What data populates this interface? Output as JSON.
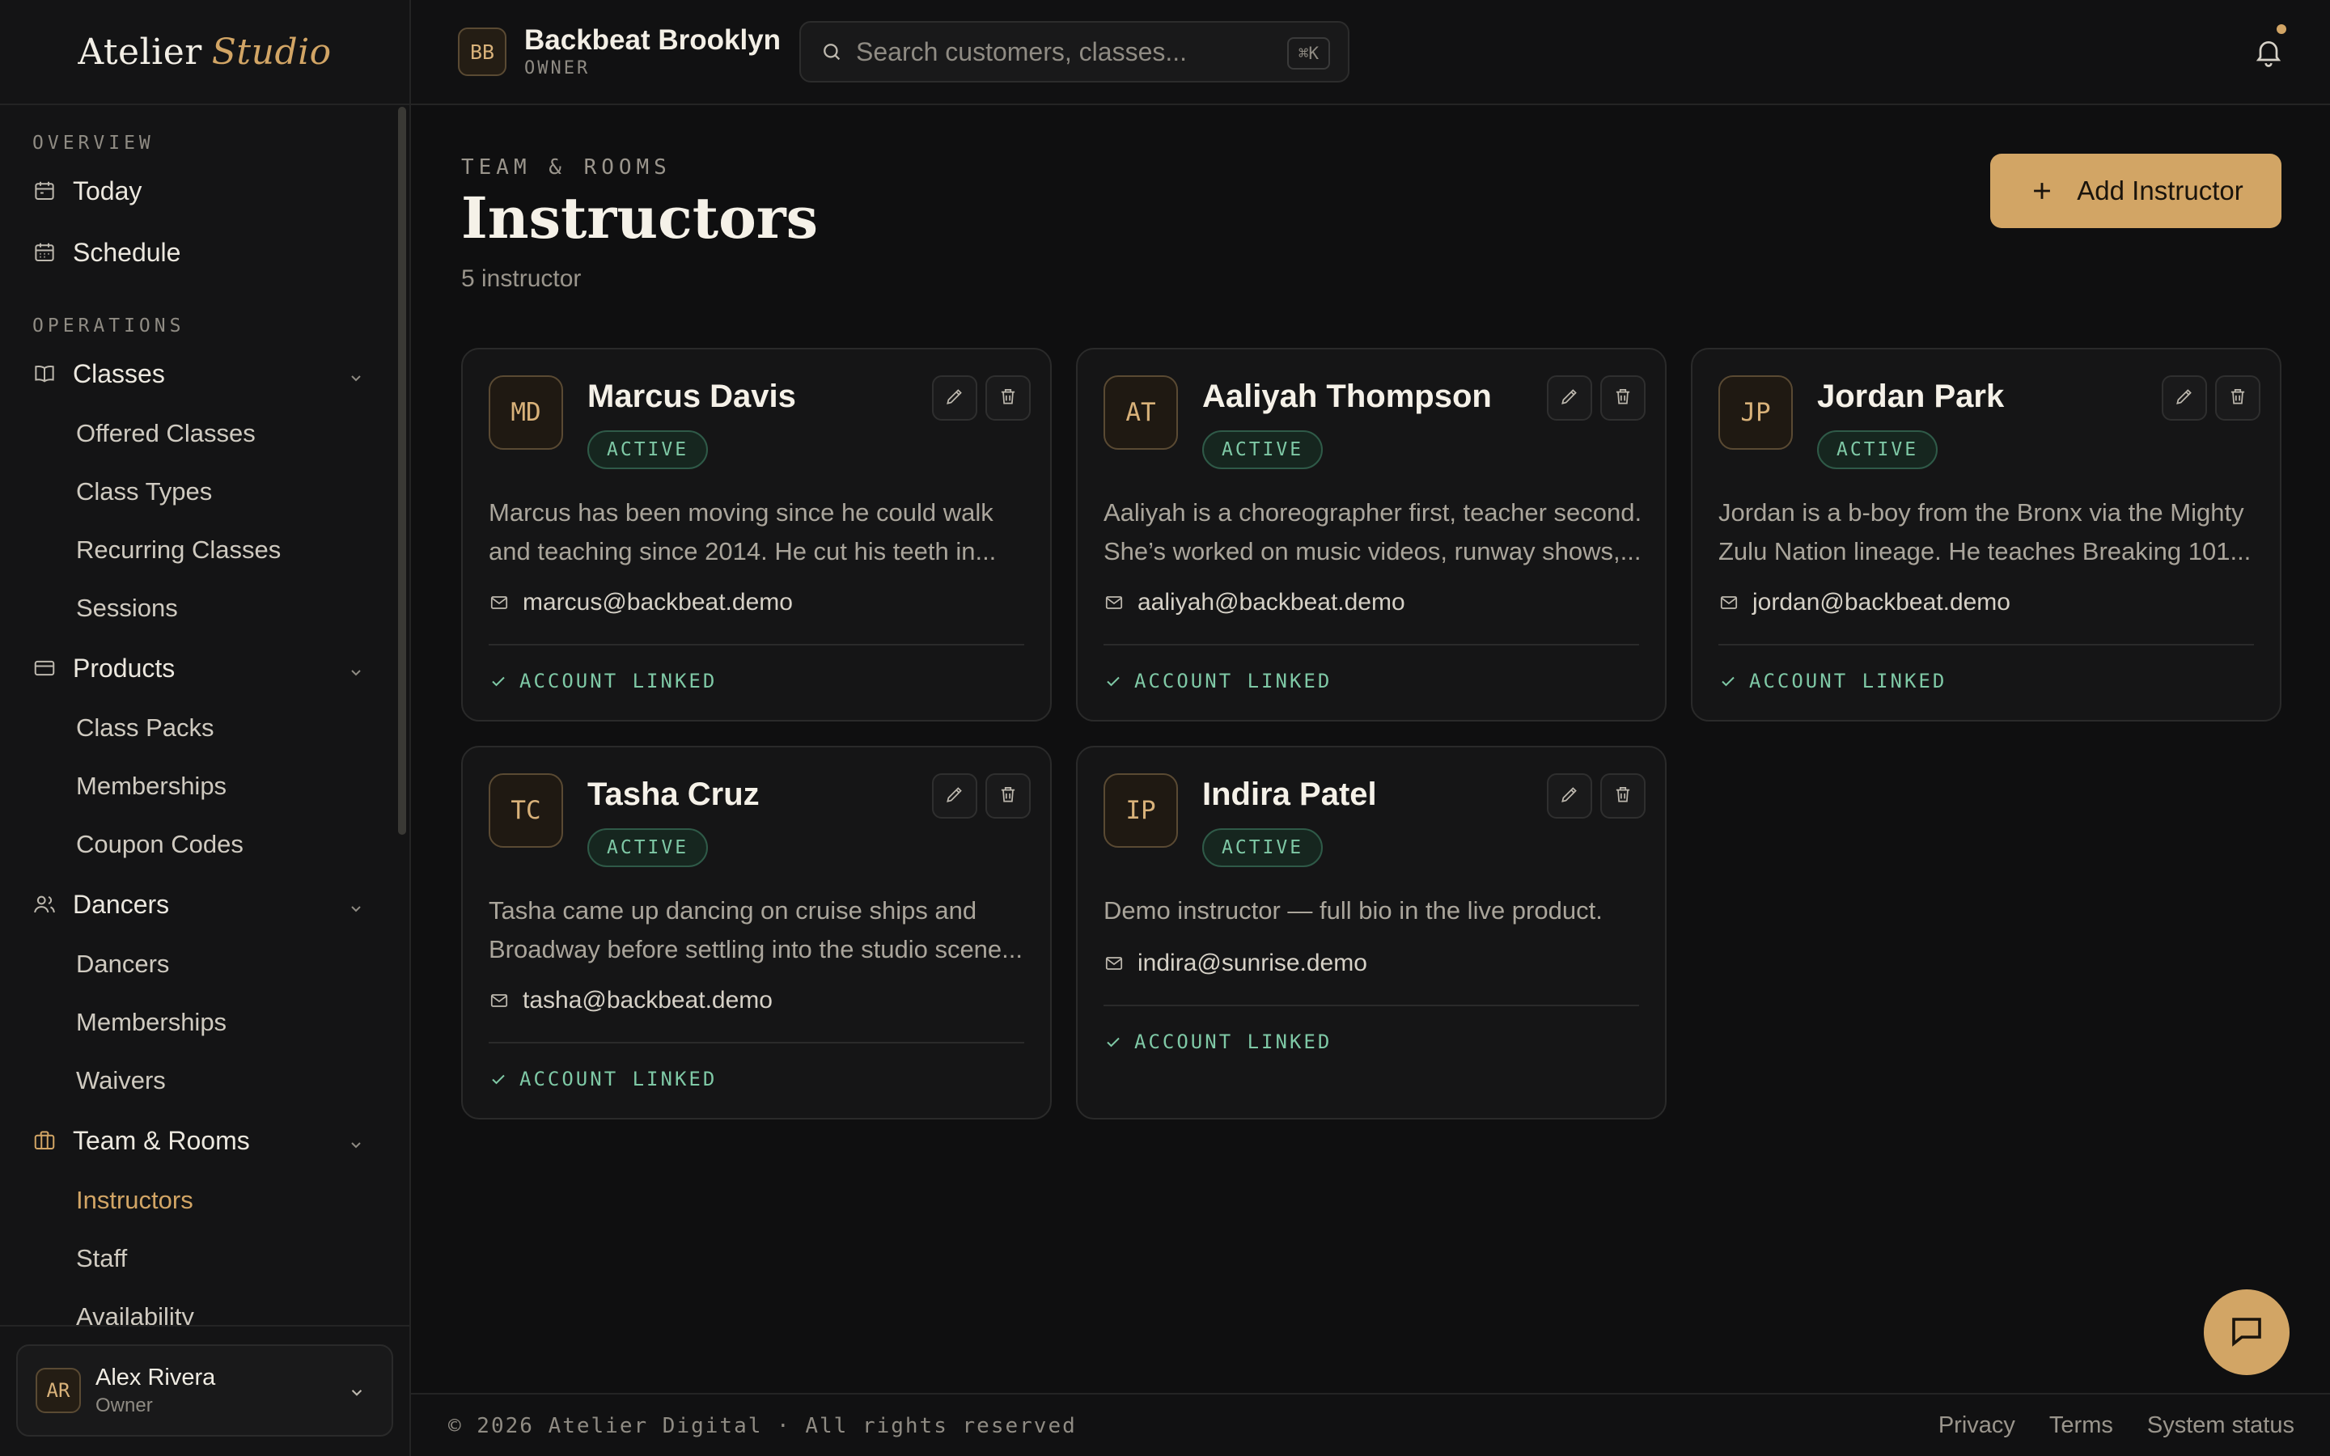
{
  "brand": {
    "name": "Atelier",
    "accent": "Studio"
  },
  "sidebar": {
    "sections": [
      {
        "label": "OVERVIEW"
      },
      {
        "label": "OPERATIONS"
      }
    ],
    "today": "Today",
    "schedule": "Schedule",
    "classes": {
      "label": "Classes",
      "items": [
        "Offered Classes",
        "Class Types",
        "Recurring Classes",
        "Sessions"
      ]
    },
    "products": {
      "label": "Products",
      "items": [
        "Class Packs",
        "Memberships",
        "Coupon Codes"
      ]
    },
    "dancers": {
      "label": "Dancers",
      "items": [
        "Dancers",
        "Memberships",
        "Waivers"
      ]
    },
    "team": {
      "label": "Team & Rooms",
      "items": [
        "Instructors",
        "Staff",
        "Availability"
      ]
    },
    "user": {
      "initials": "AR",
      "name": "Alex Rivera",
      "role": "Owner"
    }
  },
  "header": {
    "org_initials": "BB",
    "org_name": "Backbeat Brooklyn",
    "org_role": "OWNER",
    "search_placeholder": "Search customers, classes...",
    "search_shortcut": "⌘K"
  },
  "page": {
    "eyebrow": "TEAM & ROOMS",
    "title": "Instructors",
    "subtitle": "5 instructor",
    "add_button": "Add Instructor"
  },
  "instructors": [
    {
      "initials": "MD",
      "name": "Marcus Davis",
      "status": "ACTIVE",
      "bio": [
        "Marcus has been moving since he could walk",
        "and teaching since 2014. He cut his teeth in..."
      ],
      "email": "marcus@backbeat.demo",
      "linked": "ACCOUNT LINKED"
    },
    {
      "initials": "AT",
      "name": "Aaliyah Thompson",
      "status": "ACTIVE",
      "bio": [
        "Aaliyah is a choreographer first, teacher second.",
        "She’s worked on music videos, runway shows,..."
      ],
      "email": "aaliyah@backbeat.demo",
      "linked": "ACCOUNT LINKED"
    },
    {
      "initials": "JP",
      "name": "Jordan Park",
      "status": "ACTIVE",
      "bio": [
        "Jordan is a b-boy from the Bronx via the Mighty",
        "Zulu Nation lineage. He teaches Breaking 101..."
      ],
      "email": "jordan@backbeat.demo",
      "linked": "ACCOUNT LINKED"
    },
    {
      "initials": "TC",
      "name": "Tasha Cruz",
      "status": "ACTIVE",
      "bio": [
        "Tasha came up dancing on cruise ships and",
        "Broadway before settling into the studio scene..."
      ],
      "email": "tasha@backbeat.demo",
      "linked": "ACCOUNT LINKED"
    },
    {
      "initials": "IP",
      "name": "Indira Patel",
      "status": "ACTIVE",
      "bio": [
        "Demo instructor — full bio in the live product."
      ],
      "email": "indira@sunrise.demo",
      "linked": "ACCOUNT LINKED"
    }
  ],
  "footer": {
    "copyright": "© 2026 Atelier Digital · All rights reserved",
    "links": [
      "Privacy",
      "Terms",
      "System status"
    ]
  },
  "colors": {
    "accent": "#d2a565",
    "success": "#7fc9a6",
    "background": "#0f0f10"
  }
}
